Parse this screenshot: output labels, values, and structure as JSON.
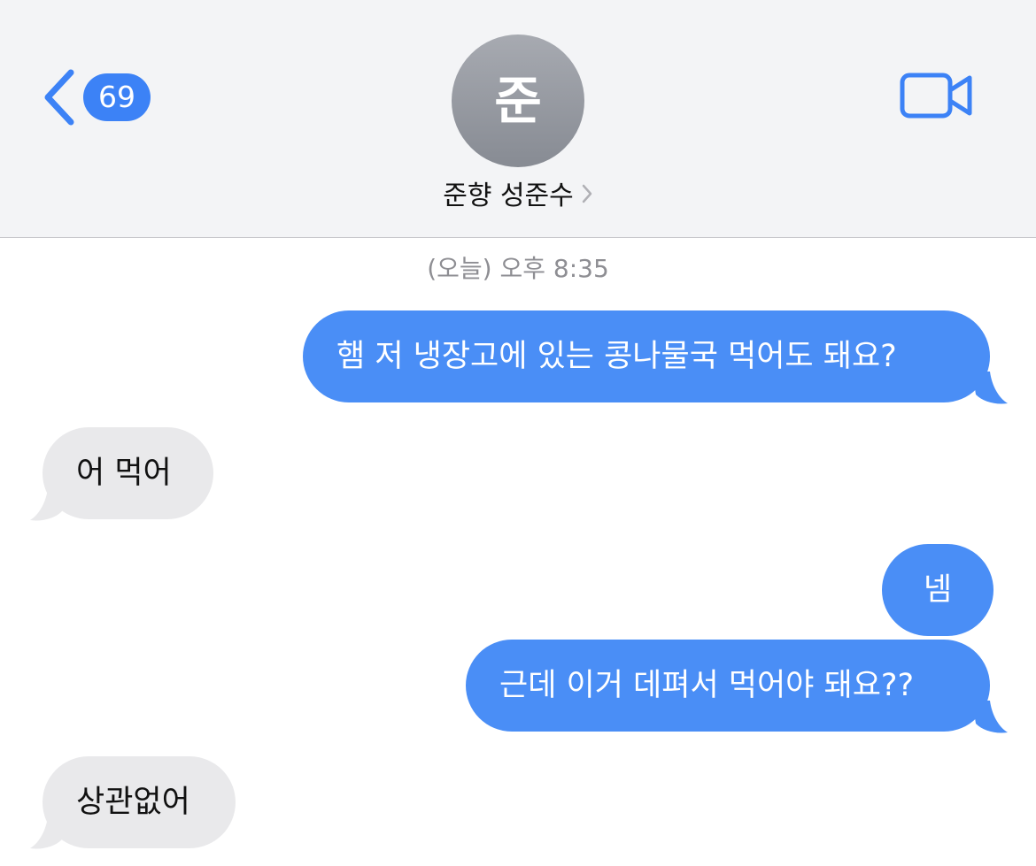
{
  "header": {
    "back_count": "69",
    "avatar_initial": "준",
    "contact_name": "준향 성준수"
  },
  "timestamp": "(오늘) 오후 8:35",
  "messages": [
    {
      "from": "me",
      "text": "햄 저 냉장고에 있는 콩나물국 먹어도 돼요?"
    },
    {
      "from": "them",
      "text": "어 먹어"
    },
    {
      "from": "me",
      "text": "넴"
    },
    {
      "from": "me",
      "text": "근데 이거 데펴서 먹어야 돼요??"
    },
    {
      "from": "them",
      "text": "상관없어"
    }
  ],
  "colors": {
    "accent": "#3c82f6",
    "outgoing_bubble": "#4a8ef6",
    "incoming_bubble": "#e9e9eb"
  }
}
